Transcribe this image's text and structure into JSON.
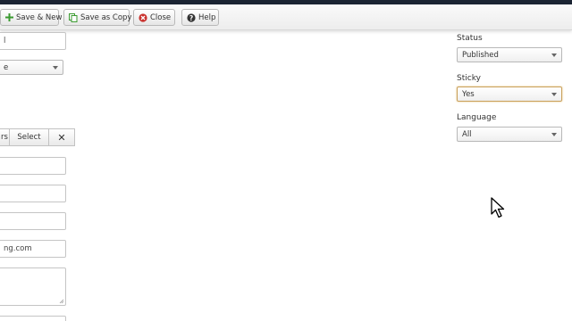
{
  "toolbar": {
    "save_new_label": "Save & New",
    "save_copy_label": "Save as Copy",
    "close_label": "Close",
    "help_label": "Help"
  },
  "left_form": {
    "field1_value": "l",
    "select1_value": "e",
    "user_select": {
      "partial_label": "rs",
      "select_label": "Select",
      "clear_symbol": "✕"
    },
    "field_website_value": "ng.com"
  },
  "right_panel": {
    "status": {
      "label": "Status",
      "value": "Published"
    },
    "sticky": {
      "label": "Sticky",
      "value": "Yes"
    },
    "language": {
      "label": "Language",
      "value": "All"
    }
  },
  "colors": {
    "accent_green": "#3a9a2f",
    "close_red": "#c9302c",
    "topbar": "#1b2433"
  },
  "icons": {
    "save_new": "plus-icon",
    "save_copy": "copy-icon",
    "close": "close-circle-icon",
    "help": "help-circle-icon",
    "cursor": "mouse-pointer-icon"
  }
}
